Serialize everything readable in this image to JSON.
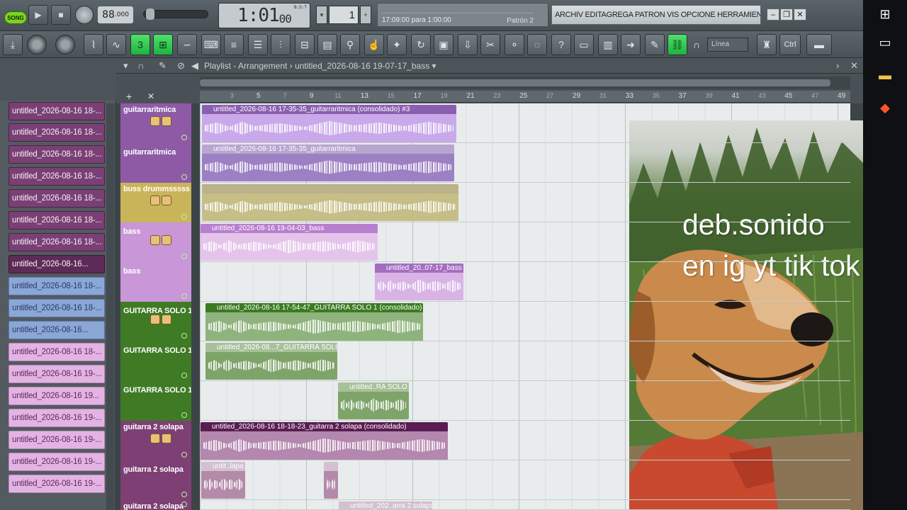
{
  "transport": {
    "song_label": "SONG",
    "tempo": "88",
    "tempo_decimals": ".000",
    "time": "1:01",
    "time_ticks": "00",
    "time_unit": "B:S:T",
    "pattern_number": "1",
    "hint_text": "17:09:00 para 1:00:00",
    "hint_pattern": "Patrón 2",
    "menu_text": "ARCHIV EDITAGREGA PATRON VIS OPCIONE HERRAMIENTA",
    "win_minimize": "–",
    "win_maximize": "❐",
    "win_close": "✕"
  },
  "toolbar": {
    "snap_label": "Línea",
    "ctrl_label": "Ctrl",
    "tools_on_color": "#2fcf52"
  },
  "playlist": {
    "title": "Playlist - Arrangement",
    "arrangement": "untitled_2026-08-16 19-07-17_bass",
    "ruler_major": [
      "5",
      "9",
      "13",
      "17",
      "21",
      "25",
      "29",
      "33",
      "37",
      "41",
      "45",
      "49"
    ],
    "ruler_minor": [
      "3",
      "7",
      "11",
      "15",
      "19",
      "23",
      "27",
      "31",
      "35",
      "39",
      "43",
      "47"
    ]
  },
  "browser": {
    "items": [
      "untitled_2026-08-16 18-...",
      "untitled_2026-08-16 18-...",
      "untitled_2026-08-16 18-...",
      "untitled_2026-08-16 18-...",
      "untitled_2026-08-16 18-...",
      "untitled_2026-08-16 18-...",
      "untitled_2026-08-16 18-...",
      "untitled_2026-08-16...",
      "untitled_2026-08-16 18-...",
      "untitled_2026-08-16 18-...",
      "untitled_2026-08-16...",
      "untitled_2026-08-16 18-...",
      "untitled_2026-08-16 19-...",
      "untitled_2026-08-16 19...",
      "untitled_2026-08-16 19-...",
      "untitled_2026-08-16 19-...",
      "untitled_2026-08-16 19-...",
      "untitled_2026-08-16 19-..."
    ]
  },
  "tracks": [
    {
      "name": "guitarraritmica",
      "color": "#8e5aa6"
    },
    {
      "name": "guitarraritmica",
      "color": "#8e5aa6"
    },
    {
      "name": "buss drummsssss",
      "color": "#c9b45a"
    },
    {
      "name": "bass",
      "color": "#c996d8"
    },
    {
      "name": "bass",
      "color": "#c996d8"
    },
    {
      "name": "GUITARRA SOLO 1",
      "color": "#3f7a25"
    },
    {
      "name": "GUITARRA SOLO 1",
      "color": "#3f7a25"
    },
    {
      "name": "GUITARRA SOLO 1",
      "color": "#3f7a25"
    },
    {
      "name": "guitarra 2 solapa",
      "color": "#7d3f74"
    },
    {
      "name": "guitarra 2 solapa",
      "color": "#7d3f74"
    },
    {
      "name": "guitarra 2 solapa",
      "color": "#7d3f74"
    }
  ],
  "clips": [
    {
      "label": "untitled_2026-08-16 17-35-35_guitarraritmica (consolidado) #3",
      "bg": "#c9a9ea",
      "cap": "#8b5fb0"
    },
    {
      "label": "untitled_2026-08-16 17-35-35_guitarraritmica",
      "bg": "#9d80c4",
      "cap": "#b7a6cf"
    },
    {
      "label": "",
      "bg": "#c6bd87",
      "cap": "#b9b28a"
    },
    {
      "label": "untitled_2026-08-16 19-04-03_bass",
      "bg": "#e5c4ec",
      "cap": "#b77fcd"
    },
    {
      "label": "untitled_20..07-17_bass",
      "bg": "#d9b3e6",
      "cap": "#a46ec0"
    },
    {
      "label": "untitled_2026-08-16 17-54-47_GUITARRA SOLO 1 (consolidado)",
      "bg": "#8fb37c",
      "cap": "#3b7a22"
    },
    {
      "label": "untitled_2026-08...7_GUITARRA SOLO 1",
      "bg": "#7fa46a",
      "cap": "#a9c09b"
    },
    {
      "label": "untitled..RA SOLO 1",
      "bg": "#7fa46a",
      "cap": "#a9c09b"
    },
    {
      "label": "untitled_2026-08-16 18-18-23_guitarra 2 solapa (consolidado)",
      "bg": "#b487ae",
      "cap": "#5a1d52"
    },
    {
      "label": "untit..lapa",
      "bg": "#b38aa9",
      "cap": "#d3c0d0"
    },
    {
      "label": "",
      "bg": "#b38aa9",
      "cap": "#d3c0d0"
    },
    {
      "label": "untitled_202..arra 2 solapa",
      "bg": "#c9aac4",
      "cap": "#d3c0d0"
    }
  ],
  "overlay": {
    "line1": "deb.sonido",
    "line2": "en ig yt tik tok"
  }
}
